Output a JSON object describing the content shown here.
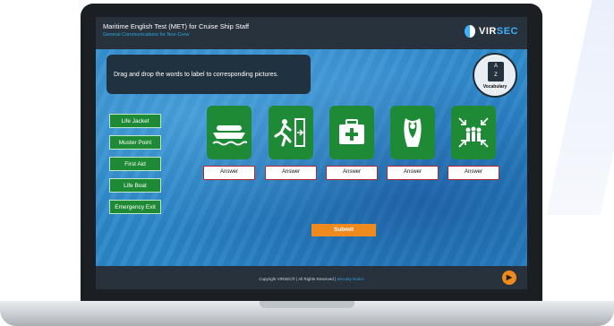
{
  "header": {
    "title": "Maritime English Test (MET) for Cruise Ship Staff",
    "subtitle": "General Communications for Non-Crew",
    "logo": {
      "prefix": "VIR",
      "suffix": "SEC"
    }
  },
  "instruction": "Drag and drop the words to label to corresponding pictures.",
  "vocabulary": {
    "label": "Vocabulary",
    "icon": "dictionary-icon"
  },
  "words": [
    "Life Jacket",
    "Muster Point",
    "First Aid",
    "Life Boat",
    "Emergency Exit"
  ],
  "pictures": [
    {
      "icon": "lifeboat-icon"
    },
    {
      "icon": "emergency-exit-icon"
    },
    {
      "icon": "first-aid-kit-icon"
    },
    {
      "icon": "life-jacket-icon"
    },
    {
      "icon": "muster-point-icon"
    }
  ],
  "answers": [
    "Answer",
    "Answer",
    "Answer",
    "Answer",
    "Answer"
  ],
  "submit_label": "Submit",
  "footer": {
    "copyright": "Copyright VIRSEC® | All Rights Reserved |",
    "link": "Security Notice"
  },
  "colors": {
    "accent": "#ef8a1e",
    "green": "#1e8a36",
    "header": "#28323d",
    "answer_border": "#b5262b"
  }
}
